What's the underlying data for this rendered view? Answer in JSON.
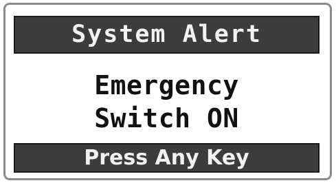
{
  "dialog": {
    "title": "System Alert",
    "message_lines": [
      "Emergency",
      "Switch ON"
    ],
    "footer_prompt": "Press Any Key"
  },
  "colors": {
    "bar_background": "#3c3c3c",
    "bar_text": "#f2f2f2",
    "message_text": "#111111",
    "frame_border": "#8a8a8a",
    "background": "#ffffff"
  }
}
